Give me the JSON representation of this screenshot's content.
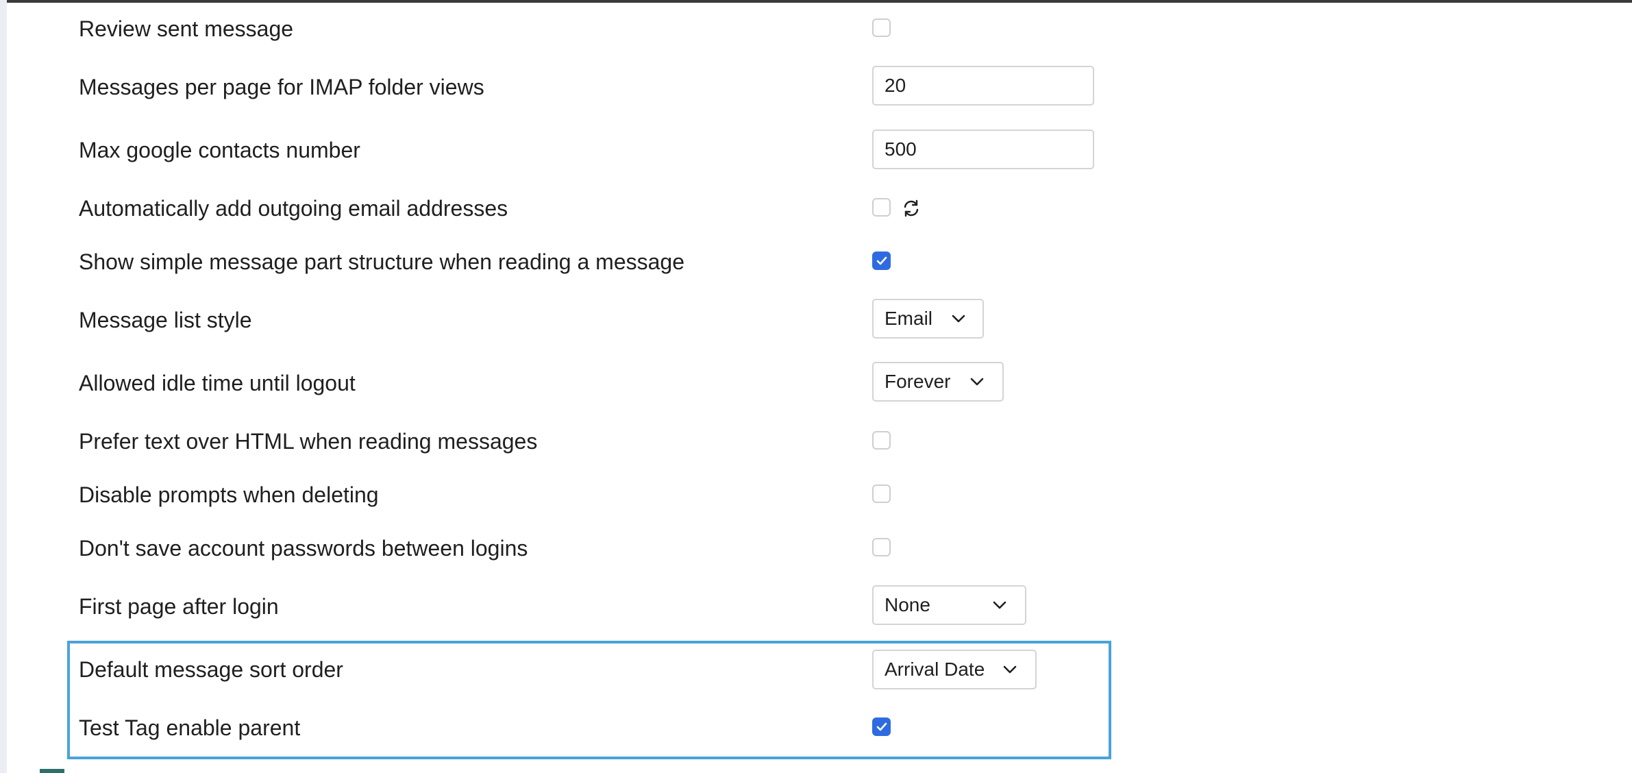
{
  "settings": [
    {
      "label": "Review sent message",
      "type": "checkbox",
      "checked": false
    },
    {
      "label": "Messages per page for IMAP folder views",
      "type": "text",
      "value": "20"
    },
    {
      "label": "Max google contacts number",
      "type": "text",
      "value": "500"
    },
    {
      "label": "Automatically add outgoing email addresses",
      "type": "checkbox",
      "checked": false,
      "icon": "refresh-icon"
    },
    {
      "label": "Show simple message part structure when reading a message",
      "type": "checkbox",
      "checked": true
    },
    {
      "label": "Message list style",
      "type": "select",
      "value": "Email"
    },
    {
      "label": "Allowed idle time until logout",
      "type": "select",
      "value": "Forever"
    },
    {
      "label": "Prefer text over HTML when reading messages",
      "type": "checkbox",
      "checked": false
    },
    {
      "label": "Disable prompts when deleting",
      "type": "checkbox",
      "checked": false
    },
    {
      "label": "Don't save account passwords between logins",
      "type": "checkbox",
      "checked": false
    },
    {
      "label": "First page after login",
      "type": "select",
      "value": "None"
    },
    {
      "label": "Default message sort order",
      "type": "select",
      "value": "Arrival Date"
    },
    {
      "label": "Test Tag enable parent",
      "type": "checkbox",
      "checked": true
    }
  ],
  "colors": {
    "checkbox_checked": "#2f6be0",
    "highlight_border": "#4aa3d8"
  }
}
